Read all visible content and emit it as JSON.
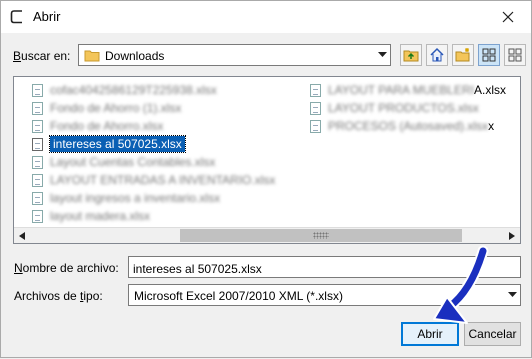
{
  "window": {
    "title": "Abrir",
    "close_icon": "close-icon"
  },
  "location": {
    "label_prefix": "B",
    "label_rest": "uscar en:",
    "folder": "Downloads",
    "folder_icon": "folder-icon"
  },
  "toolbar": {
    "buttons": [
      "up-folder-icon",
      "home-icon",
      "new-folder-icon",
      "details-view-icon",
      "list-view-icon"
    ]
  },
  "files": {
    "left_column": [
      "cofac4042586129T225938.xlsx",
      "Fondo de Ahorro (1).xlsx",
      "Fondo de Ahorro.xlsx",
      "intereses al 507025.xlsx",
      "Layout  Cuentas Contables.xlsx",
      "LAYOUT ENTRADAS A INVENTARIO.xlsx",
      "layout ingresos a inventario.xlsx",
      "layout madera.xlsx"
    ],
    "right_column_blurred": [
      "LAYOUT PARA MUEBLERI",
      "LAYOUT PRODUCTOS.xlsx",
      "PROCESOS (Autosaved).xlsx"
    ],
    "right_column_visible_suffix": [
      "A.xlsx",
      "",
      "x"
    ],
    "selected": "intereses al 507025.xlsx"
  },
  "filename": {
    "label_prefix": "N",
    "label_rest": "ombre de archivo:",
    "value": "intereses al 507025.xlsx"
  },
  "filetype": {
    "label_prefix": "Archivos de ",
    "label_underline": "t",
    "label_rest": "ipo:",
    "value": "Microsoft Excel 2007/2010 XML (*.xlsx)"
  },
  "actions": {
    "open": "Abrir",
    "cancel": "Cancelar"
  },
  "colors": {
    "selection": "#0a5fb4",
    "accent": "#0078d7",
    "annotation_arrow": "#1a2fbf"
  }
}
